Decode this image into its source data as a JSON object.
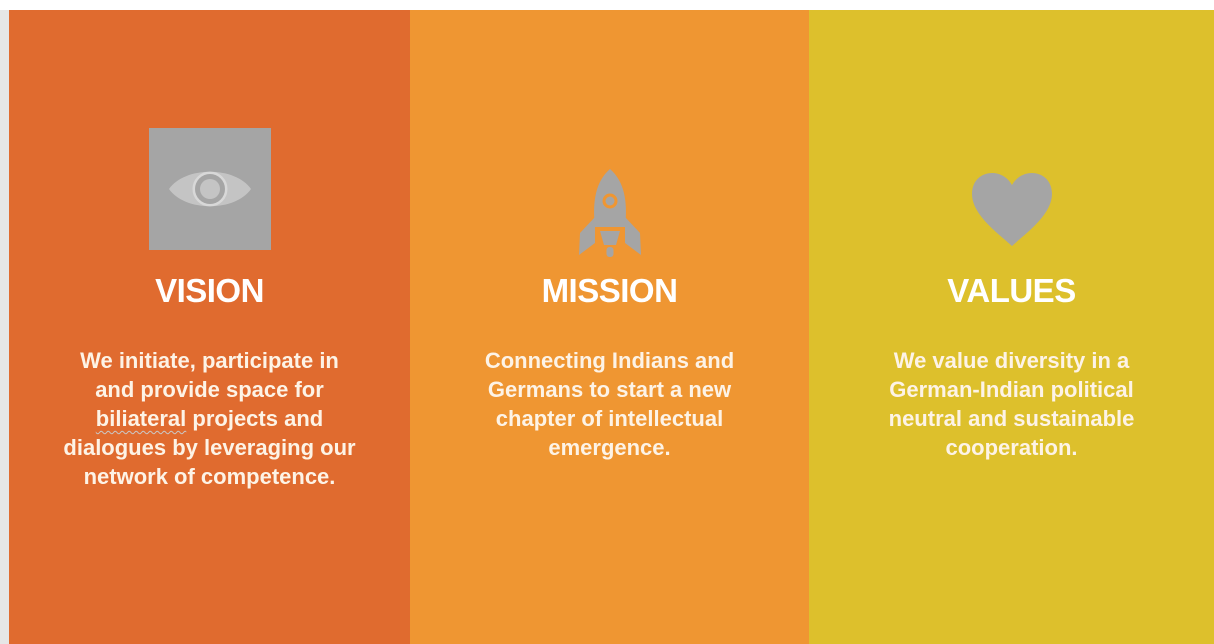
{
  "colors": {
    "vision_bg": "#e06b2f",
    "mission_bg": "#ef9632",
    "values_bg": "#ddc02c",
    "icon_gray": "#a5a5a5",
    "text_light": "#fdf3e6"
  },
  "panels": [
    {
      "id": "vision",
      "icon": "eye-icon",
      "title": "VISION",
      "text_lines": [
        "We initiate, participate in",
        "and provide space for",
        [
          "biliateral",
          " projects and"
        ],
        "dialogues by leveraging our",
        "network of competence."
      ]
    },
    {
      "id": "mission",
      "icon": "rocket-icon",
      "title": "MISSION",
      "text_lines": [
        "Connecting Indians and",
        "Germans to start a new",
        "chapter of intellectual",
        "emergence."
      ]
    },
    {
      "id": "values",
      "icon": "heart-icon",
      "title": "VALUES",
      "text_lines": [
        "We value diversity in a",
        "German-Indian political",
        "neutral and sustainable",
        "cooperation."
      ]
    }
  ]
}
